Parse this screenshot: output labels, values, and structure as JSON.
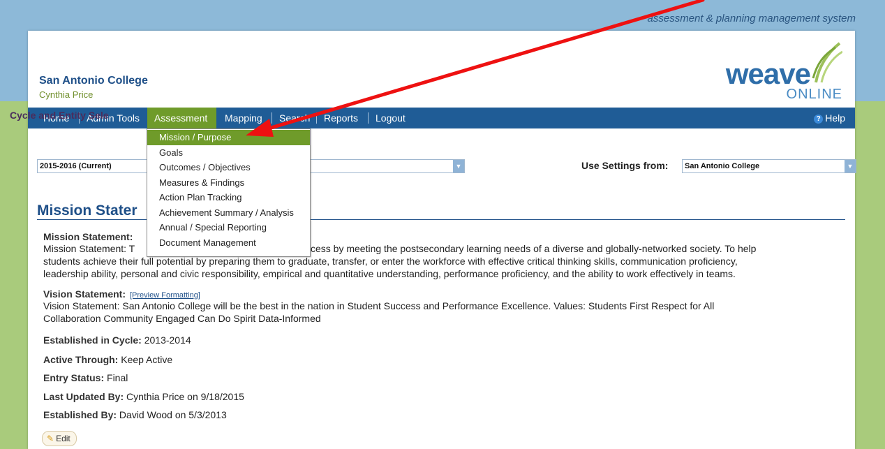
{
  "header": {
    "tagline": "assessment & planning management system",
    "college": "San Antonio College",
    "user": "Cynthia Price",
    "logo_word": "weave",
    "logo_online": "ONLINE"
  },
  "nav": {
    "items": [
      "Home",
      "Admin Tools",
      "Assessment",
      "Mapping",
      "Search",
      "Reports",
      "Logout"
    ],
    "help": "Help",
    "help_badge": "?"
  },
  "dropdown": {
    "items": [
      "Mission / Purpose",
      "Goals",
      "Outcomes / Objectives",
      "Measures & Findings",
      "Action Plan Tracking",
      "Achievement Summary / Analysis",
      "Annual / Special Reporting",
      "Document Management"
    ],
    "highlighted_index": 0
  },
  "selection": {
    "label": "Cycle and Entity Sele",
    "cycle_value": "2015-2016  (Current)",
    "settings_label": "Use Settings from:",
    "settings_value": "San Antonio College"
  },
  "mission": {
    "section_title": "Mission Stater",
    "heading": "Mission Statement:",
    "line1_left": "Mission Statement: T",
    "line1_right": "cess by meeting the postsecondary learning needs of a diverse and globally-networked society. To help",
    "line2_left": "students achieve their full potential by preparing them to graduate, transfer, or enter the workforce with effective critical thinking skills, communication proficiency,",
    "line3": "leadership ability, personal and civic responsibility, empirical and quantitative understanding, performance proficiency, and the ability to work effectively in teams.",
    "vision_heading": "Vision Statement:",
    "preview_link": "[Preview Formatting]",
    "vision_line1": "Vision Statement: San Antonio College will be the best in the nation in Student Success and Performance Excellence. Values: Students First Respect for All",
    "vision_line2": "Collaboration Community Engaged Can Do Spirit Data-Informed",
    "established_label": "Established in Cycle:",
    "established_value": "2013-2014",
    "active_label": "Active Through:",
    "active_value": "Keep Active",
    "status_label": "Entry Status:",
    "status_value": "Final",
    "updated_label": "Last Updated By:",
    "updated_value": "Cynthia Price on 9/18/2015",
    "established_by_label": "Established By:",
    "established_by_value": "David Wood on 5/3/2013",
    "edit_label": "Edit"
  },
  "colors": {
    "nav_bar": "#1f5c96",
    "active_nav": "#6f9b2a",
    "annotation_arrow": "#ee1111"
  }
}
